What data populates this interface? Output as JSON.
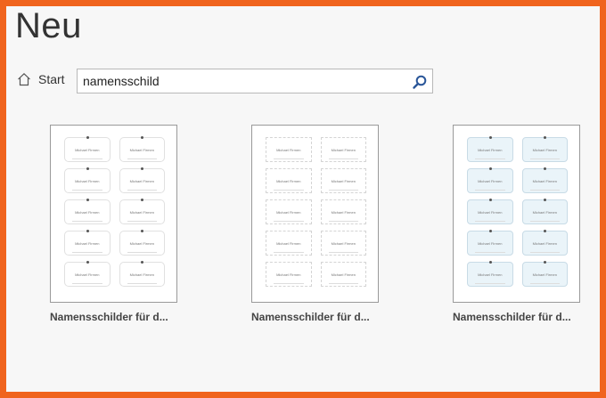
{
  "page": {
    "title": "Neu"
  },
  "nav": {
    "home_label": "Start"
  },
  "search": {
    "value": "namensschild"
  },
  "templates": [
    {
      "caption": "Namensschilder für d...",
      "card_text": "Michael Firmen"
    },
    {
      "caption": "Namensschilder für d...",
      "card_text": "Michael Firmen"
    },
    {
      "caption": "Namensschilder für d...",
      "card_text": "Michael Firmen"
    }
  ],
  "icons": {
    "home": "home-icon",
    "search": "search-icon"
  },
  "colors": {
    "frame_border": "#f0641e",
    "background": "#f7f7f7",
    "accent": "#2a5699"
  }
}
